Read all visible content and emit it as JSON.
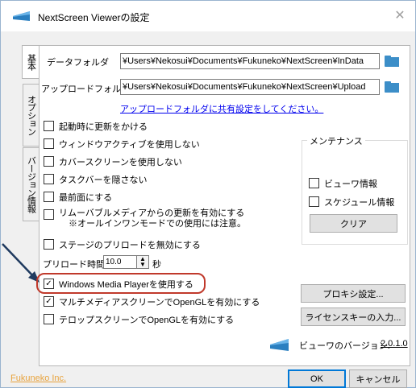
{
  "window": {
    "title": "NextScreen Viewerの設定",
    "close_glyph": "✕"
  },
  "tabs": [
    {
      "label": "基本",
      "active": true
    },
    {
      "label": "オプション",
      "active": false
    },
    {
      "label": "バージョン情報",
      "active": false
    }
  ],
  "data_folder": {
    "label": "データフォルダ",
    "value": "¥Users¥Nekosui¥Documents¥Fukuneko¥NextScreen¥InData"
  },
  "upload_folder": {
    "label": "アップロードフォルダ",
    "value": "¥Users¥Nekosui¥Documents¥Fukuneko¥NextScreen¥Upload",
    "share_link": "アップロードフォルダに共有設定をしてください。"
  },
  "checkboxes": [
    {
      "label": "起動時に更新をかける",
      "checked": false
    },
    {
      "label": "ウィンドウアクティブを使用しない",
      "checked": false
    },
    {
      "label": "カバースクリーンを使用しない",
      "checked": false
    },
    {
      "label": "タスクバーを隠さない",
      "checked": false
    },
    {
      "label": "最前面にする",
      "checked": false
    },
    {
      "label": "リムーバブルメディアからの更新を有効にする",
      "label2": "※オールインワンモードでの使用には注意。",
      "checked": false
    },
    {
      "label": "ステージのプリロードを無効にする",
      "checked": false
    }
  ],
  "preload": {
    "label": "プリロード時間",
    "value": "10.0",
    "unit": "秒"
  },
  "options": [
    {
      "label": "Windows Media Playerを使用する",
      "checked": true
    },
    {
      "label": "マルチメディアスクリーンでOpenGLを有効にする",
      "checked": true
    },
    {
      "label": "テロップスクリーンでOpenGLを有効にする",
      "checked": false
    }
  ],
  "maintenance": {
    "title": "メンテナンス",
    "viewer_info": "ビューワ情報",
    "schedule_info": "スケジュール情報",
    "clear_label": "クリア"
  },
  "buttons": {
    "proxy": "プロキシ設定...",
    "license": "ライセンスキーの入力...",
    "ok": "OK",
    "cancel": "キャンセル"
  },
  "version": {
    "label": "ビューワのバージョン:",
    "value": "2.0.1.0"
  },
  "footer_link": "Fukuneko Inc.",
  "colors": {
    "accent": "#0078d7",
    "highlight_oval": "#c0392b",
    "link": "#0000ee",
    "footer_link": "#e8a33d",
    "folder_icon": "#3c8ec8"
  }
}
